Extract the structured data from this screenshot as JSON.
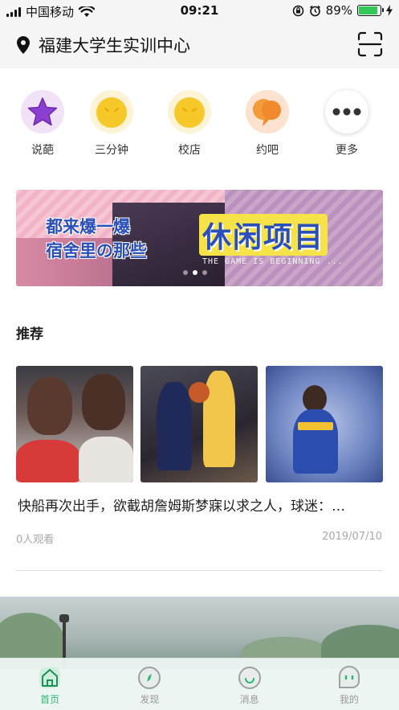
{
  "status_bar": {
    "carrier": "中国移动",
    "time": "09:21",
    "battery_percent": "89%",
    "battery_level": 0.89
  },
  "header": {
    "location_title": "福建大学生实训中心",
    "icons": [
      "location-pin-icon",
      "scan-icon"
    ]
  },
  "quick_menu": [
    {
      "label": "说葩",
      "icon": "star-icon",
      "color": "#8a3fd1"
    },
    {
      "label": "三分钟",
      "icon": "smile-face-icon",
      "color": "#f5c518"
    },
    {
      "label": "校店",
      "icon": "smile-face-icon",
      "color": "#f5c518"
    },
    {
      "label": "约吧",
      "icon": "chat-bubble-icon",
      "color": "#f08a2c"
    },
    {
      "label": "更多",
      "icon": "more-dots-icon",
      "color": "#333333"
    }
  ],
  "banner": {
    "line1": "都来爆一爆",
    "line2": "宿舍里の那些",
    "big_text": "休闲项目",
    "subtext": "THE GAME IS BEGINNING ...",
    "slide_count": 3,
    "active_slide": 1
  },
  "recommend": {
    "title": "推荐",
    "article_title": "快船再次出手，欲截胡詹姆斯梦寐以求之人，球迷：…",
    "views": "0人观看",
    "date": "2019/07/10"
  },
  "tabbar": {
    "tabs": [
      {
        "label": "首页",
        "icon": "home-icon",
        "active": true
      },
      {
        "label": "发现",
        "icon": "compass-icon",
        "active": false
      },
      {
        "label": "消息",
        "icon": "message-icon",
        "active": false
      },
      {
        "label": "我的",
        "icon": "profile-icon",
        "active": false
      }
    ],
    "active_color": "#2bb673"
  }
}
